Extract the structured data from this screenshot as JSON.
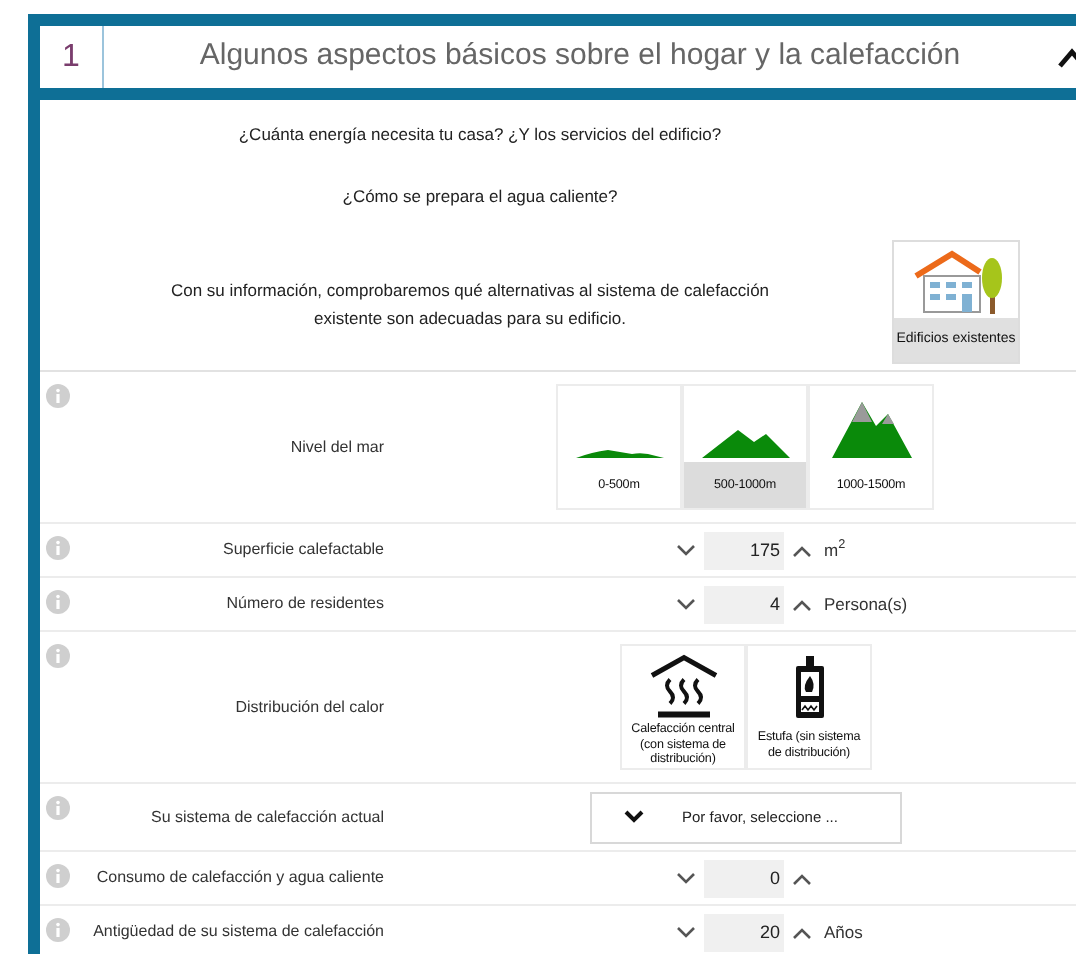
{
  "section": {
    "number": "1",
    "title": "Algunos aspectos básicos sobre el hogar y la calefacción",
    "expanded": true
  },
  "intro": {
    "questions": [
      "¿Cuánta energía necesita tu casa? ¿Y los servicios del edificio?",
      "¿Cómo se prepara el agua caliente?"
    ],
    "note": "Con su información, comprobaremos qué alternativas al sistema de calefacción existente son adecuadas para su edificio.",
    "building_type": {
      "label": "Edificios existentes",
      "selected": true
    }
  },
  "fields": [
    {
      "kind": "altitude",
      "label": "Nivel del mar",
      "options": [
        {
          "label": "0-500m",
          "selected": false
        },
        {
          "label": "500-1000m",
          "selected": true
        },
        {
          "label": "1000-1500m",
          "selected": false
        }
      ]
    },
    {
      "kind": "spinner",
      "label": "Superficie calefactable",
      "value": "175",
      "unit": "m$^{2}$"
    },
    {
      "kind": "spinner",
      "label": "Número de residentes",
      "value": "4",
      "unit": "Persona(s)"
    },
    {
      "kind": "distribution",
      "label": "Distribución del calor",
      "options": [
        {
          "label": "Calefacción central (con sistema de distribución)",
          "selected": false
        },
        {
          "label": "Estufa (sin sistema de distribución)",
          "selected": false
        }
      ]
    },
    {
      "kind": "select",
      "label": "Su sistema de calefacción actual",
      "placeholder": "Por favor, seleccione ..."
    },
    {
      "kind": "spinner",
      "label": "Consumo de calefacción y agua caliente",
      "value": "0"
    },
    {
      "kind": "spinner",
      "label": "Antigüedad de su sistema de calefacción",
      "value": "20",
      "unit": "Años"
    }
  ]
}
